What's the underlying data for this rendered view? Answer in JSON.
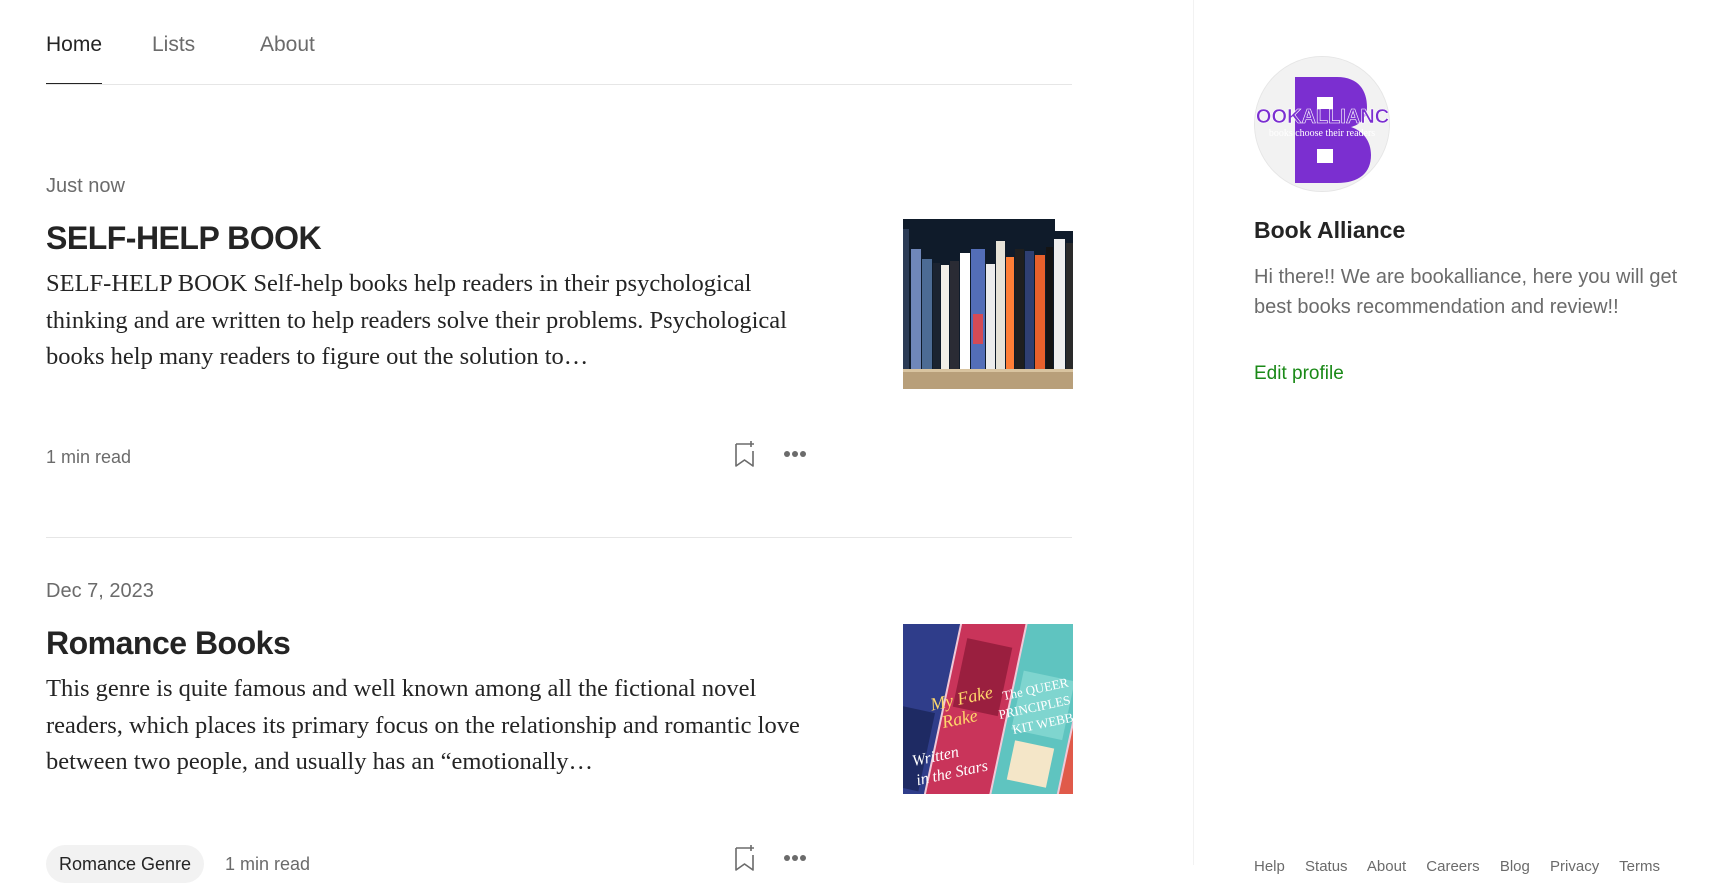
{
  "tabs": [
    {
      "label": "Home",
      "active": true
    },
    {
      "label": "Lists",
      "active": false
    },
    {
      "label": "About",
      "active": false
    }
  ],
  "posts": [
    {
      "date": "Just now",
      "title": "SELF-HELP BOOK",
      "excerpt": "SELF-HELP BOOK Self-help books help readers in their psychological thinking and are written to help readers solve their problems. Psychological books help many readers to figure out the solution to…",
      "read_time": "1 min read",
      "tag": null,
      "thumbnail": "bookshelf-photo"
    },
    {
      "date": "Dec 7, 2023",
      "title": "Romance Books",
      "excerpt": "This genre is quite famous and well known among all the fictional novel readers, which places its primary focus on the relationship and romantic love between two people, and usually has an “emotionally…",
      "read_time": "1 min read",
      "tag": "Romance Genre",
      "thumbnail": "romance-book-covers-collage"
    }
  ],
  "sidebar": {
    "avatar_text": "BOOKALLIANCE",
    "avatar_subtext": "books choose their readers",
    "name": "Book Alliance",
    "bio": "Hi there!! We are bookalliance, here you will get best books recommendation and review!!",
    "edit_label": "Edit profile",
    "footer_links": [
      "Help",
      "Status",
      "About",
      "Careers",
      "Blog",
      "Privacy",
      "Terms"
    ]
  },
  "colors": {
    "accent_green": "#1a8917",
    "brand_purple": "#7b2fd0",
    "text_primary": "#242424",
    "text_secondary": "#6b6b6b"
  },
  "icons": {
    "save": "bookmark-add-icon",
    "more": "more-horizontal-icon"
  }
}
